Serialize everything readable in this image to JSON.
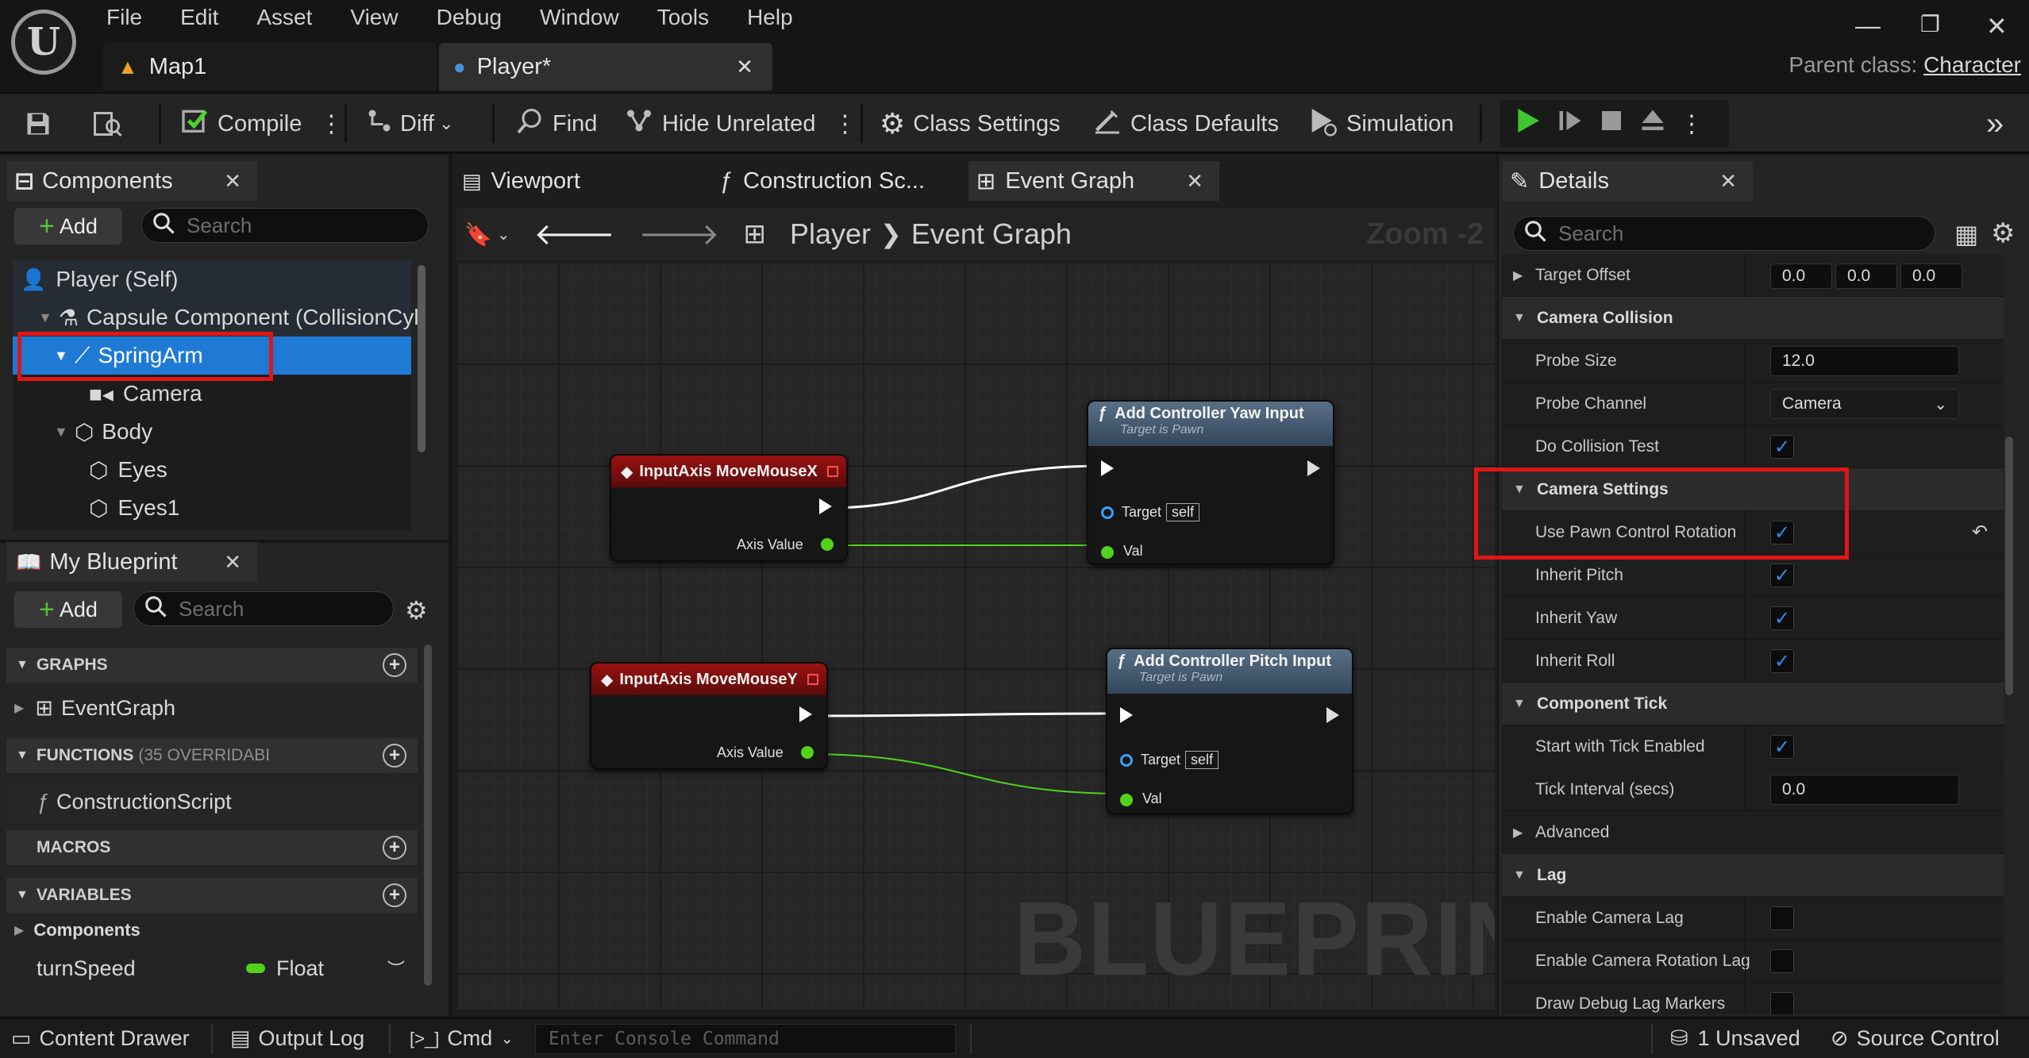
{
  "menu": [
    "File",
    "Edit",
    "Asset",
    "View",
    "Debug",
    "Window",
    "Tools",
    "Help"
  ],
  "tabs": {
    "map": "Map1",
    "player": "Player*"
  },
  "parent_class": {
    "label": "Parent class:",
    "value": "Character"
  },
  "toolbar": {
    "compile": "Compile",
    "diff": "Diff",
    "find": "Find",
    "hide_unrelated": "Hide Unrelated",
    "class_settings": "Class Settings",
    "class_defaults": "Class Defaults",
    "simulation": "Simulation"
  },
  "components": {
    "tab": "Components",
    "add": "Add",
    "search_placeholder": "Search",
    "items": [
      "Player (Self)",
      "Capsule Component (CollisionCyl",
      "SpringArm",
      "Camera",
      "Body",
      "Eyes",
      "Eyes1"
    ]
  },
  "my_blueprint": {
    "tab": "My Blueprint",
    "add": "Add",
    "search_placeholder": "Search",
    "graphs": "GRAPHS",
    "event_graph": "EventGraph",
    "functions": "FUNCTIONS",
    "functions_note": "(35 OVERRIDABI",
    "construction_script": "ConstructionScript",
    "macros": "MACROS",
    "variables": "VARIABLES",
    "components_group": "Components",
    "var_name": "turnSpeed",
    "var_type": "Float"
  },
  "graph_tabs": {
    "viewport": "Viewport",
    "construction": "Construction Sc...",
    "event_graph": "Event Graph"
  },
  "breadcrumb": {
    "root": "Player",
    "current": "Event Graph",
    "zoom": "Zoom -2"
  },
  "watermark": "BLUEPRINT",
  "nodes": {
    "mousex": {
      "title": "InputAxis MoveMouseX",
      "pin": "Axis Value"
    },
    "mousey": {
      "title": "InputAxis MoveMouseY",
      "pin": "Axis Value"
    },
    "yaw": {
      "title": "Add Controller Yaw Input",
      "sub": "Target is Pawn",
      "target": "Target",
      "self": "self",
      "val": "Val"
    },
    "pitch": {
      "title": "Add Controller Pitch Input",
      "sub": "Target is Pawn",
      "target": "Target",
      "self": "self",
      "val": "Val"
    }
  },
  "details": {
    "tab": "Details",
    "search_placeholder": "Search",
    "target_offset": {
      "label": "Target Offset",
      "x": "0.0",
      "y": "0.0",
      "z": "0.0"
    },
    "camera_collision": "Camera Collision",
    "probe_size": {
      "label": "Probe Size",
      "value": "12.0"
    },
    "probe_channel": {
      "label": "Probe Channel",
      "value": "Camera"
    },
    "do_collision_test": "Do Collision Test",
    "camera_settings": "Camera Settings",
    "use_pawn_control_rotation": "Use Pawn Control Rotation",
    "inherit_pitch": "Inherit Pitch",
    "inherit_yaw": "Inherit Yaw",
    "inherit_roll": "Inherit Roll",
    "component_tick": "Component Tick",
    "start_tick": "Start with Tick Enabled",
    "tick_interval": {
      "label": "Tick Interval (secs)",
      "value": "0.0"
    },
    "advanced": "Advanced",
    "lag": "Lag",
    "enable_camera_lag": "Enable Camera Lag",
    "enable_rotation_lag": "Enable Camera Rotation Lag",
    "draw_debug": "Draw Debug Lag Markers"
  },
  "status": {
    "content_drawer": "Content Drawer",
    "output_log": "Output Log",
    "cmd": "Cmd",
    "console_placeholder": "Enter Console Command",
    "unsaved": "1 Unsaved",
    "source_control": "Source Control"
  },
  "colors": {
    "accent": "#1f7ad6",
    "highlight": "#e01515",
    "exec": "#ffffff",
    "float_pin": "#52d21a",
    "object_pin": "#3aa0ff",
    "node_red": "#8c1010",
    "node_blue": "#4a6076",
    "play": "#3fc630",
    "check": "#2f8ff0"
  }
}
